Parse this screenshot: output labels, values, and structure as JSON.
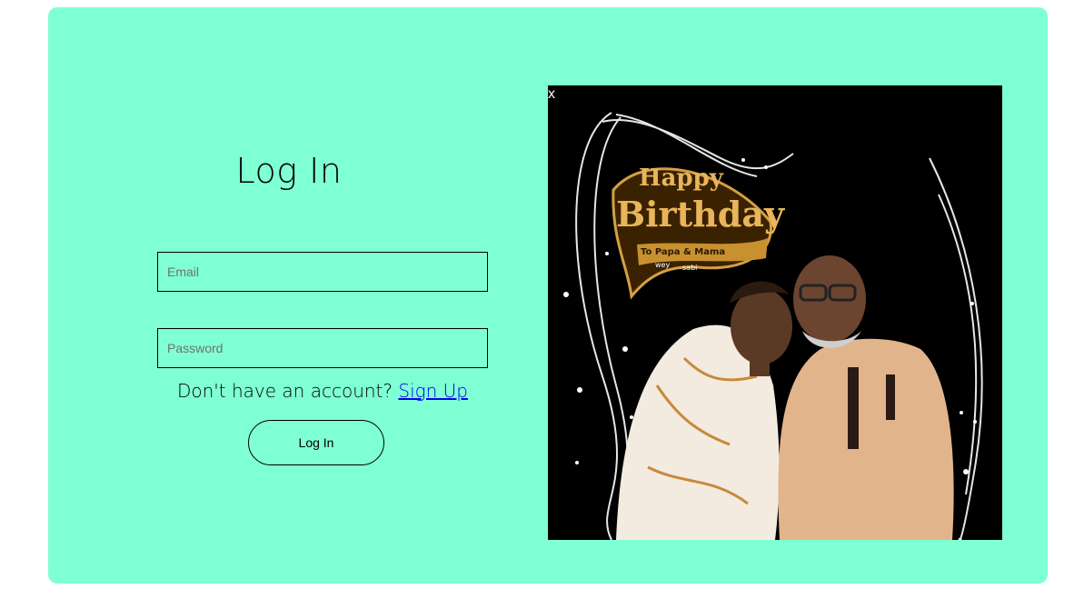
{
  "login": {
    "title": "Log In",
    "email_placeholder": "Email",
    "password_placeholder": "Password",
    "signup_prompt": "Don't have an account?",
    "signup_link": "Sign Up",
    "submit_label": "Log In"
  },
  "popup": {
    "close_label": "x",
    "banner_line1": "Happy",
    "banner_line2": "Birthday",
    "banner_line3": "To Papa & Mama",
    "banner_line4": "wey",
    "banner_line5": "sabi"
  },
  "colors": {
    "card_background": "#7fffd4",
    "link": "#0000ee",
    "photo_background": "#000000",
    "banner_gold": "#d4a043"
  }
}
